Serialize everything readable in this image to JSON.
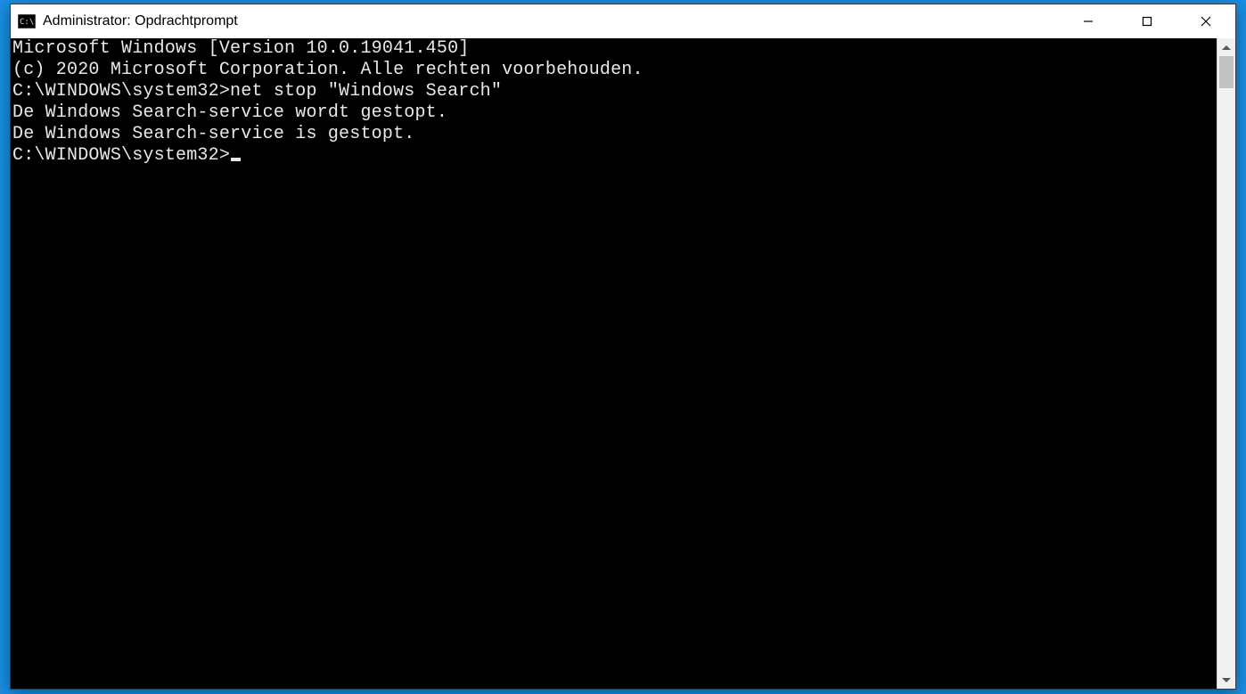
{
  "window": {
    "title": "Administrator: Opdrachtprompt"
  },
  "terminal": {
    "lines": [
      "Microsoft Windows [Version 10.0.19041.450]",
      "(c) 2020 Microsoft Corporation. Alle rechten voorbehouden.",
      "",
      "C:\\WINDOWS\\system32>net stop \"Windows Search\"",
      "De Windows Search-service wordt gestopt.",
      "De Windows Search-service is gestopt.",
      "",
      ""
    ],
    "prompt": "C:\\WINDOWS\\system32>"
  }
}
